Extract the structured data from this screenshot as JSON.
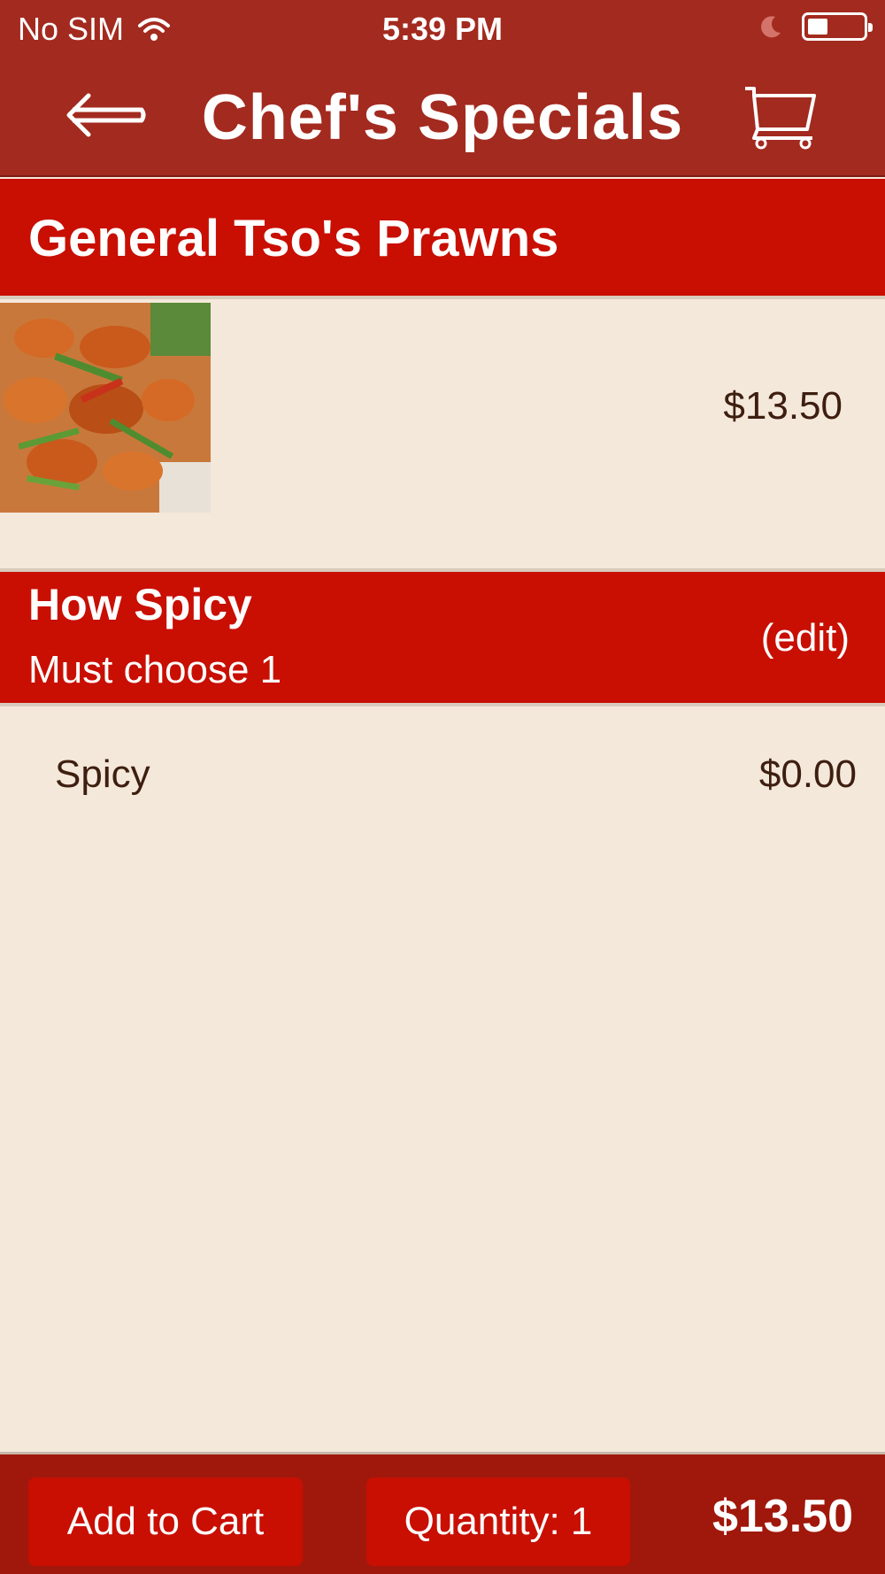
{
  "status_bar": {
    "carrier": "No SIM",
    "time": "5:39 PM",
    "icons": [
      "wifi-icon",
      "moon-icon",
      "battery-icon"
    ],
    "battery_level": 0.35
  },
  "nav": {
    "title": "Chef's Specials",
    "back_icon": "back-arrow-icon",
    "cart_icon": "cart-icon"
  },
  "item": {
    "name": "General Tso's Prawns",
    "price": "$13.50"
  },
  "option_group": {
    "title": "How Spicy",
    "subtitle": "Must choose 1",
    "edit_label": "(edit)",
    "options": [
      {
        "label": "Spicy",
        "price": "$0.00"
      }
    ]
  },
  "footer": {
    "add_to_cart_label": "Add to Cart",
    "quantity_label": "Quantity: 1",
    "total": "$13.50"
  },
  "colors": {
    "header_dark_red": "#a32a1f",
    "section_red": "#c80f02",
    "background_cream": "#f4e8db",
    "footer_red": "#a0180b",
    "text_brown": "#3d1e0f"
  }
}
